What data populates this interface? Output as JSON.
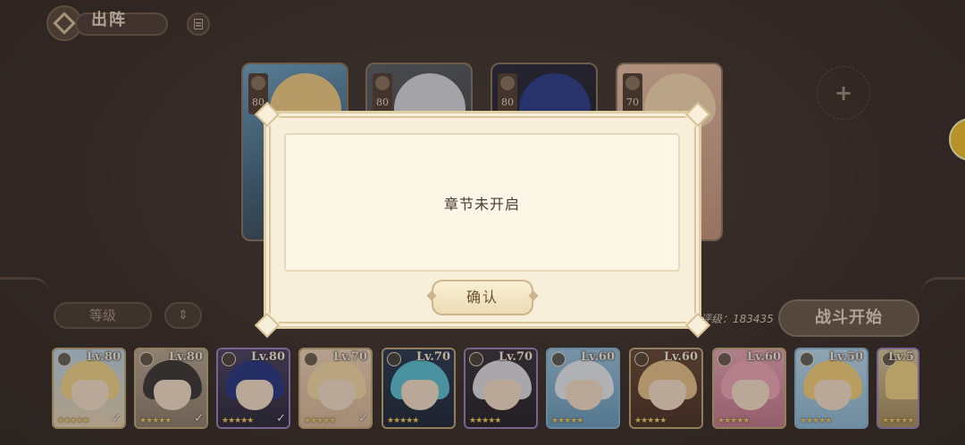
{
  "header": {
    "title": "出阵"
  },
  "team_slots": [
    {
      "level": "80"
    },
    {
      "level": "80"
    },
    {
      "level": "80"
    },
    {
      "level": "70"
    }
  ],
  "controls": {
    "sort_label": "等级",
    "score_text": "综合评级：183435",
    "battle_label": "战斗开始"
  },
  "roster": [
    {
      "level": "Lv.80",
      "stars": "★★★★★",
      "selected": true
    },
    {
      "level": "Lv.80",
      "stars": "★★★★★",
      "selected": true
    },
    {
      "level": "Lv.80",
      "stars": "★★★★★",
      "selected": true
    },
    {
      "level": "Lv.70",
      "stars": "★★★★★",
      "selected": true
    },
    {
      "level": "Lv.70",
      "stars": "★★★★★",
      "selected": false
    },
    {
      "level": "Lv.70",
      "stars": "★★★★★",
      "selected": false
    },
    {
      "level": "Lv.60",
      "stars": "★★★★★",
      "selected": false
    },
    {
      "level": "Lv.60",
      "stars": "★★★★★",
      "selected": false
    },
    {
      "level": "Lv.60",
      "stars": "★★★★★",
      "selected": false
    },
    {
      "level": "Lv.50",
      "stars": "★★★★★",
      "selected": false
    },
    {
      "level": "Lv.5",
      "stars": "★★★★★",
      "selected": false
    }
  ],
  "dialog": {
    "message": "章节未开启",
    "confirm_label": "确认"
  },
  "colors": {
    "background": "#3e3430",
    "dialog_bg": "#f7efd9",
    "accent_gold": "#f0cd6a"
  }
}
